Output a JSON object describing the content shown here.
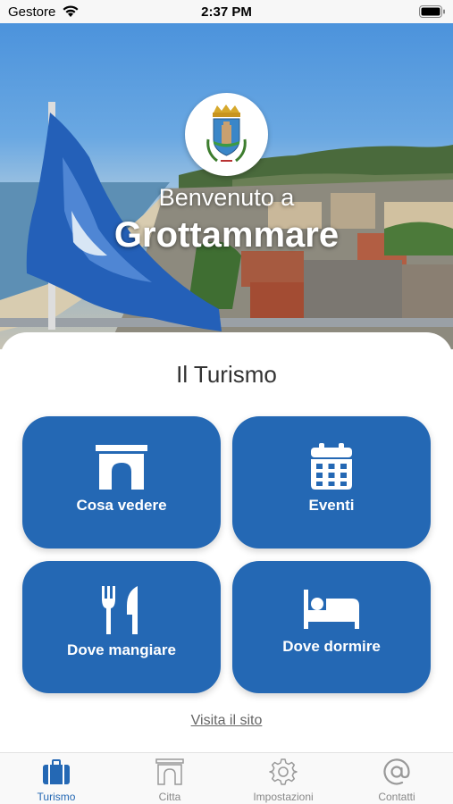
{
  "status_bar": {
    "carrier": "Gestore",
    "time": "2:37 PM"
  },
  "hero": {
    "welcome": "Benvenuto a",
    "city": "Grottammare"
  },
  "section": {
    "title": "Il Turismo"
  },
  "tiles": [
    {
      "label": "Cosa vedere",
      "icon": "arch-icon"
    },
    {
      "label": "Eventi",
      "icon": "calendar-icon"
    },
    {
      "label": "Dove mangiare",
      "icon": "fork-knife-icon"
    },
    {
      "label": "Dove dormire",
      "icon": "bed-icon"
    }
  ],
  "link": {
    "label": "Visita il sito"
  },
  "tabbar": {
    "items": [
      {
        "label": "Turismo",
        "icon": "suitcase-icon",
        "active": true
      },
      {
        "label": "Citta",
        "icon": "arch-icon",
        "active": false
      },
      {
        "label": "Impostazioni",
        "icon": "gear-icon",
        "active": false
      },
      {
        "label": "Contatti",
        "icon": "at-icon",
        "active": false
      }
    ]
  },
  "colors": {
    "accent": "#2468b4",
    "inactive": "#888888"
  }
}
